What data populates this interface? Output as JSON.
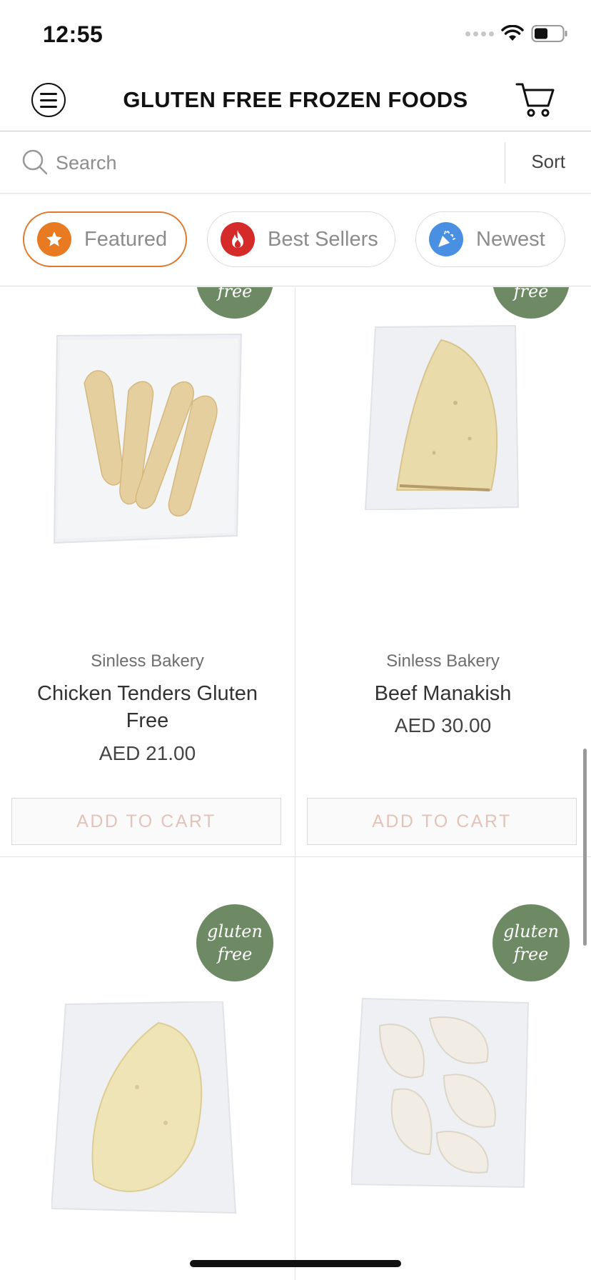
{
  "status_bar": {
    "time": "12:55"
  },
  "header": {
    "title": "GLUTEN FREE FROZEN FOODS"
  },
  "search": {
    "placeholder": "Search",
    "sort_label": "Sort"
  },
  "filters": [
    {
      "label": "Featured",
      "icon": "star-icon",
      "color": "#e87a22",
      "active": true
    },
    {
      "label": "Best Sellers",
      "icon": "flame-icon",
      "color": "#d42a2a",
      "active": false
    },
    {
      "label": "Newest",
      "icon": "party-popper-icon",
      "color": "#4a90e2",
      "active": false
    }
  ],
  "badge": {
    "line1": "gluten",
    "line2": "free",
    "color": "#6d8a64"
  },
  "products": [
    {
      "brand": "Sinless Bakery",
      "name": "Chicken Tenders Gluten Free",
      "price": "AED 21.00",
      "button": "ADD TO CART"
    },
    {
      "brand": "Sinless Bakery",
      "name": "Beef Manakish",
      "price": "AED 30.00",
      "button": "ADD TO CART"
    }
  ]
}
